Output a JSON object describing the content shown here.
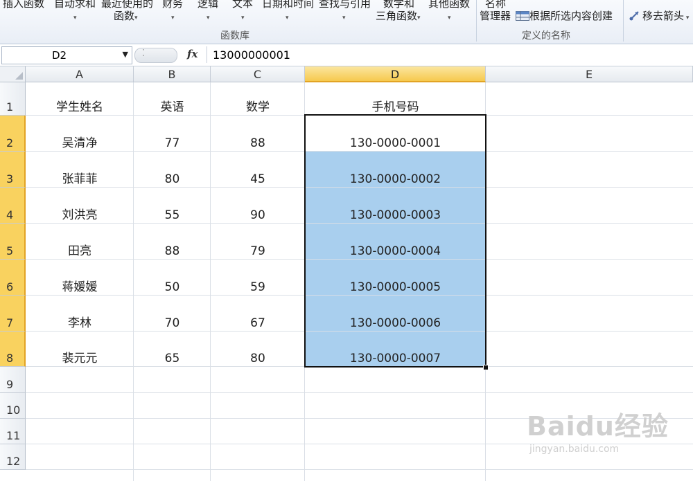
{
  "ribbon": {
    "buttons": [
      {
        "id": "insert_function",
        "line1": "插入函数",
        "line2": ""
      },
      {
        "id": "autosum",
        "line1": "自动求和",
        "line2": ""
      },
      {
        "id": "recently_used",
        "line1": "最近使用的",
        "line2": "函数"
      },
      {
        "id": "financial",
        "line1": "财务",
        "line2": ""
      },
      {
        "id": "logical",
        "line1": "逻辑",
        "line2": ""
      },
      {
        "id": "text",
        "line1": "文本",
        "line2": ""
      },
      {
        "id": "datetime",
        "line1": "日期和时间",
        "line2": ""
      },
      {
        "id": "lookup",
        "line1": "查找与引用",
        "line2": ""
      },
      {
        "id": "math",
        "line1": "数学和",
        "line2": "三角函数"
      },
      {
        "id": "more",
        "line1": "其他函数",
        "line2": ""
      }
    ],
    "function_library_label": "函数库",
    "name_manager_line1": "名称",
    "name_manager_line2": "管理器",
    "create_from_selection": "根据所选内容创建",
    "defined_names_label": "定义的名称",
    "remove_arrows": "移去箭头"
  },
  "formula_bar": {
    "name_box": "D2",
    "fx_label": "fx",
    "formula": "13000000001"
  },
  "sheet": {
    "columns": [
      "A",
      "B",
      "C",
      "D",
      "E"
    ],
    "selected_column": "D",
    "rows": [
      "1",
      "2",
      "3",
      "4",
      "5",
      "6",
      "7",
      "8",
      "9",
      "10",
      "11",
      "12"
    ],
    "selected_rows": [
      "2",
      "3",
      "4",
      "5",
      "6",
      "7",
      "8"
    ],
    "headers": [
      "学生姓名",
      "英语",
      "数学",
      "手机号码"
    ],
    "data": [
      {
        "name": "吴清净",
        "english": "77",
        "math": "88",
        "phone": "130-0000-0001"
      },
      {
        "name": "张菲菲",
        "english": "80",
        "math": "45",
        "phone": "130-0000-0002"
      },
      {
        "name": "刘洪亮",
        "english": "55",
        "math": "90",
        "phone": "130-0000-0003"
      },
      {
        "name": "田亮",
        "english": "88",
        "math": "79",
        "phone": "130-0000-0004"
      },
      {
        "name": "蒋媛媛",
        "english": "50",
        "math": "59",
        "phone": "130-0000-0005"
      },
      {
        "name": "李林",
        "english": "70",
        "math": "67",
        "phone": "130-0000-0006"
      },
      {
        "name": "裴元元",
        "english": "65",
        "math": "80",
        "phone": "130-0000-0007"
      }
    ]
  },
  "watermark": {
    "brand": "Baidu经验",
    "url": "jingyan.baidu.com"
  },
  "colors": {
    "selection_fill": "#a9cfee",
    "header_highlight": "#f9d25f"
  }
}
